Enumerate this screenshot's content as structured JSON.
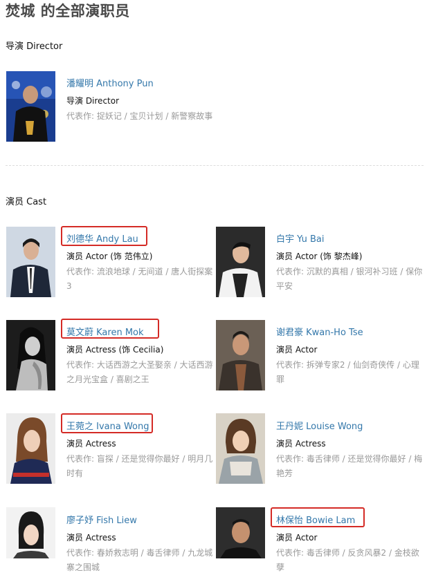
{
  "page": {
    "title": "焚城 的全部演职员"
  },
  "director_section": {
    "title": "导演 Director",
    "people": [
      {
        "name": "潘耀明 Anthony Pun",
        "role": "导演 Director",
        "works": "代表作:  捉妖记 / 宝贝计划 / 新警察故事",
        "photo_icon": "photo-director"
      }
    ]
  },
  "cast_section": {
    "title": "演员 Cast",
    "people": [
      {
        "name": "刘德华 Andy Lau",
        "role": "演员 Actor (饰 范伟立)",
        "works": "代表作:  流浪地球 / 无间道 / 唐人街探案3",
        "highlighted": true
      },
      {
        "name": "白宇 Yu Bai",
        "role": "演员 Actor (饰 黎杰峰)",
        "works": "代表作:  沉默的真相 / 银河补习班 / 保你平安",
        "highlighted": false
      },
      {
        "name": "莫文蔚 Karen Mok",
        "role": "演员 Actress (饰 Cecilia)",
        "works": "代表作:  大话西游之大圣娶亲 / 大话西游之月光宝盒 / 喜剧之王",
        "highlighted": true
      },
      {
        "name": "谢君豪 Kwan-Ho Tse",
        "role": "演员 Actor",
        "works": "代表作:  拆弹专家2 / 仙剑奇侠传 / 心理罪",
        "highlighted": false
      },
      {
        "name": "王菀之 Ivana Wong",
        "role": "演员 Actress",
        "works": "代表作:  盲探 / 还是觉得你最好 / 明月几时有",
        "highlighted": true
      },
      {
        "name": "王丹妮 Louise Wong",
        "role": "演员 Actress",
        "works": "代表作:  毒舌律师 / 还是觉得你最好 / 梅艳芳",
        "highlighted": false
      },
      {
        "name": "廖子妤 Fish Liew",
        "role": "演员 Actress",
        "works": "代表作:  春娇救志明 / 毒舌律师 / 九龙城寨之围城",
        "highlighted": false
      },
      {
        "name": "林保怡 Bowie Lam",
        "role": "演员 Actor",
        "works": "代表作:  毒舌律师 / 反贪风暴2 / 金枝欲孽",
        "highlighted": true
      }
    ]
  },
  "colors": {
    "link": "#3377aa",
    "highlight": "#d42a25",
    "muted": "#999999"
  }
}
